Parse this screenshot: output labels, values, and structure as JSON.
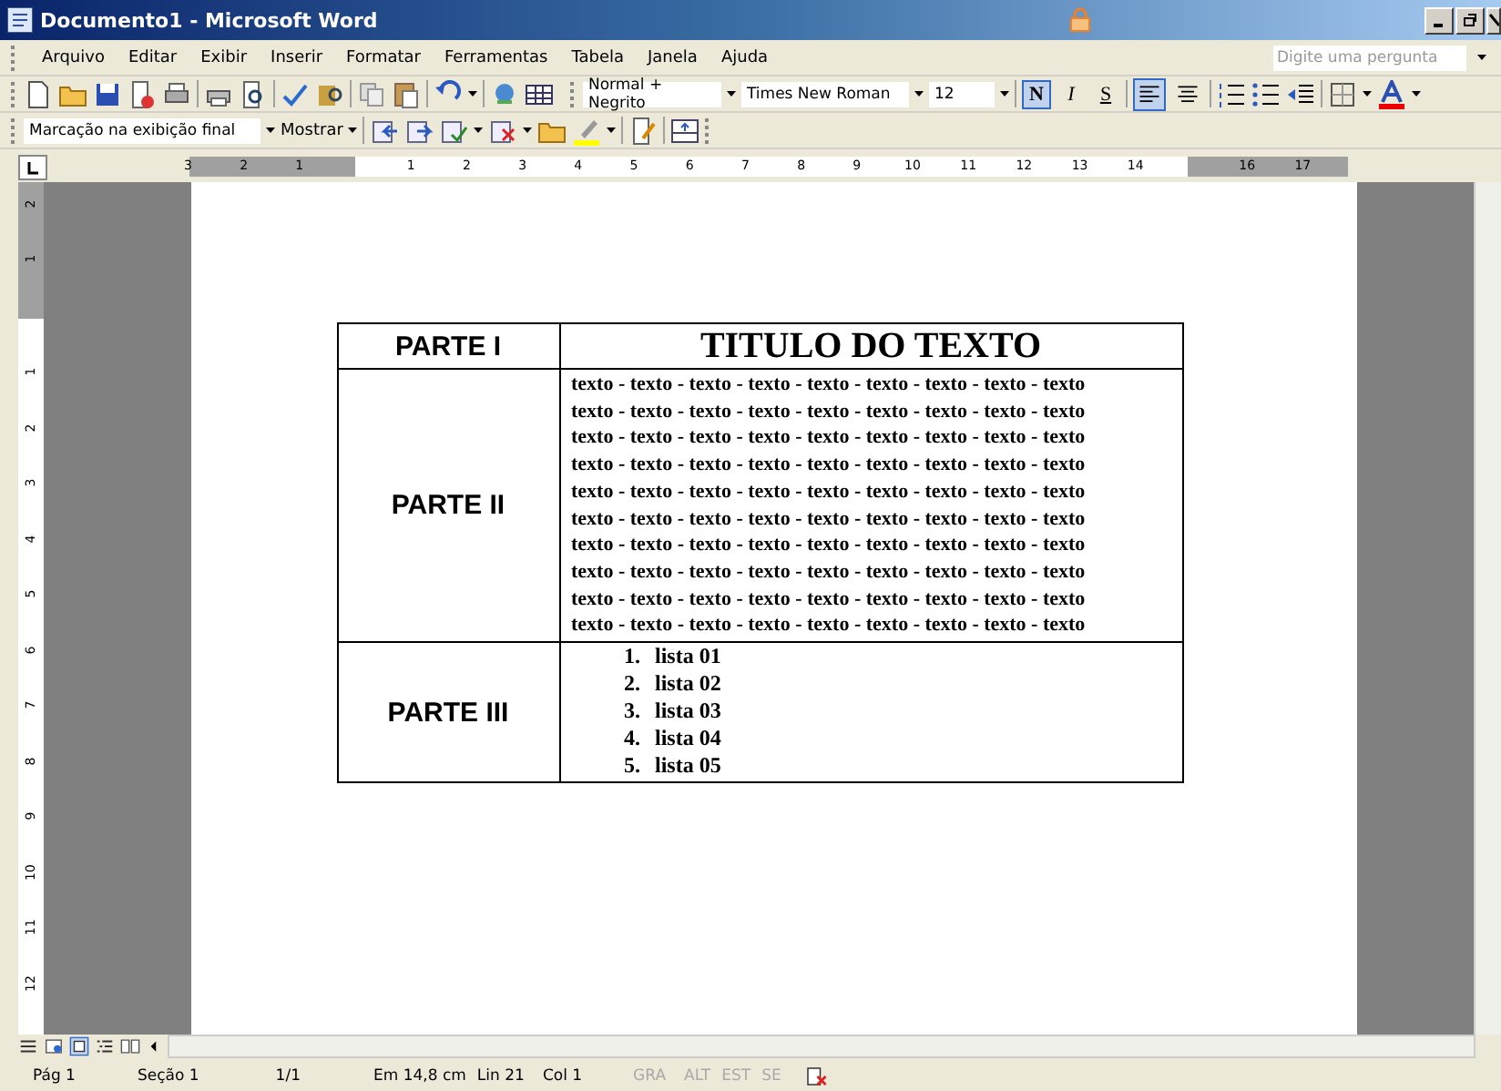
{
  "window": {
    "title": "Documento1 - Microsoft Word"
  },
  "menu": [
    "Arquivo",
    "Editar",
    "Exibir",
    "Inserir",
    "Formatar",
    "Ferramentas",
    "Tabela",
    "Janela",
    "Ajuda"
  ],
  "help_box": {
    "placeholder": "Digite uma pergunta"
  },
  "formatting": {
    "style": "Normal + Negrito",
    "font": "Times New Roman",
    "size": "12",
    "buttons": [
      {
        "label": "N",
        "kind": "bold",
        "selected": true
      },
      {
        "label": "I",
        "kind": "italic",
        "selected": false
      },
      {
        "label": "S",
        "kind": "underline",
        "selected": false
      }
    ],
    "align": [
      {
        "kind": "left",
        "selected": true
      },
      {
        "kind": "center",
        "selected": false
      }
    ]
  },
  "reviewing": {
    "display": "Marcação na exibição final",
    "show": "Mostrar"
  },
  "ruler": {
    "labels": [
      "3",
      "2",
      "1",
      "1",
      "2",
      "3",
      "4",
      "5",
      "6",
      "7",
      "8",
      "9",
      "10",
      "11",
      "12",
      "13",
      "14",
      "16",
      "17"
    ]
  },
  "vertical_ruler": {
    "labels": [
      "2",
      "1",
      "1",
      "2",
      "3",
      "4",
      "5",
      "6",
      "7",
      "8",
      "9",
      "10",
      "11",
      "12"
    ]
  },
  "table": {
    "rows": [
      {
        "label": "PARTE I",
        "kind": "title",
        "title": "TITULO DO TEXTO"
      },
      {
        "label": "PARTE II",
        "kind": "text",
        "lines": [
          "texto - texto - texto - texto - texto - texto - texto - texto - texto",
          "texto - texto - texto - texto - texto - texto - texto - texto - texto",
          "texto - texto - texto - texto - texto - texto - texto - texto - texto",
          "texto - texto - texto - texto - texto - texto - texto - texto - texto",
          "texto - texto - texto - texto - texto - texto - texto - texto - texto",
          "texto - texto - texto - texto - texto - texto - texto - texto - texto",
          "texto - texto - texto - texto - texto - texto - texto - texto - texto",
          "texto - texto - texto - texto - texto - texto - texto - texto - texto",
          "texto - texto - texto - texto - texto - texto - texto - texto - texto",
          "texto - texto - texto - texto - texto - texto - texto - texto - texto"
        ]
      },
      {
        "label": "PARTE III",
        "kind": "list",
        "items": [
          {
            "number": "1.",
            "text": "lista 01"
          },
          {
            "number": "2.",
            "text": "lista 02"
          },
          {
            "number": "3.",
            "text": "lista 03"
          },
          {
            "number": "4.",
            "text": "lista 04"
          },
          {
            "number": "5.",
            "text": "lista 05"
          }
        ]
      }
    ]
  },
  "status_bar": [
    {
      "text": "Pág 1",
      "disabled": false
    },
    {
      "text": "Seção 1",
      "disabled": false
    },
    {
      "text": "1/1",
      "disabled": false
    },
    {
      "text": "Em 14,8 cm",
      "disabled": false
    },
    {
      "text": "Lin 21",
      "disabled": false
    },
    {
      "text": "Col 1",
      "disabled": false
    },
    {
      "text": "GRA",
      "disabled": true
    },
    {
      "text": "ALT",
      "disabled": true
    },
    {
      "text": "EST",
      "disabled": true
    },
    {
      "text": "SE",
      "disabled": true
    }
  ]
}
